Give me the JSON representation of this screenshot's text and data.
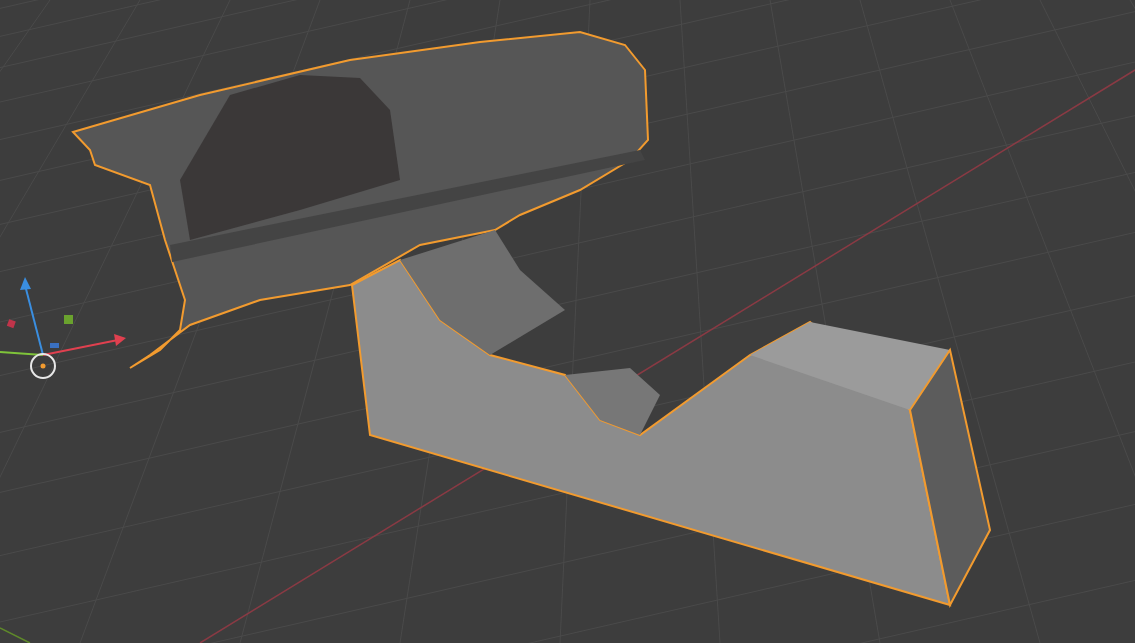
{
  "viewport": {
    "object": {
      "selected": true
    }
  }
}
